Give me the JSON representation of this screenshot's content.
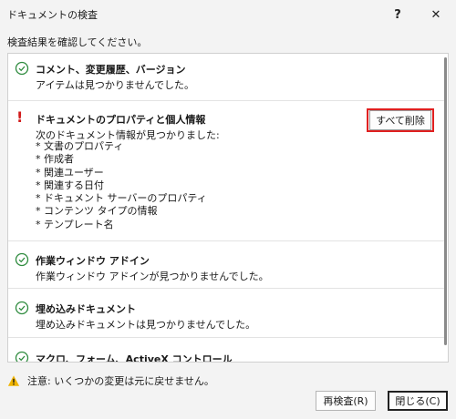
{
  "window": {
    "title": "ドキュメントの検査",
    "help_label": "?",
    "close_label": "✕"
  },
  "instruction": "検査結果を確認してください。",
  "sections": [
    {
      "status": "ok",
      "icon": "check-circle-icon",
      "title": "コメント、変更履歴、バージョン",
      "description": "アイテムは見つかりませんでした。"
    },
    {
      "status": "found",
      "icon": "exclamation-icon",
      "title": "ドキュメントのプロパティと個人情報",
      "description": "次のドキュメント情報が見つかりました:",
      "items": [
        "* 文書のプロパティ",
        "* 作成者",
        "* 関連ユーザー",
        "* 関連する日付",
        "* ドキュメント サーバーのプロパティ",
        "* コンテンツ タイプの情報",
        "* テンプレート名"
      ],
      "action_label": "すべて削除"
    },
    {
      "status": "ok",
      "icon": "check-circle-icon",
      "title": "作業ウィンドウ アドイン",
      "description": "作業ウィンドウ アドインが見つかりませんでした。"
    },
    {
      "status": "ok",
      "icon": "check-circle-icon",
      "title": "埋め込みドキュメント",
      "description": "埋め込みドキュメントは見つかりませんでした。"
    },
    {
      "status": "ok",
      "icon": "check-circle-icon",
      "title": "マクロ、フォーム、ActiveX コントロール"
    }
  ],
  "footer": {
    "warning_icon": "warning-triangle-icon",
    "warning_text": "注意: いくつかの変更は元に戻せません。",
    "recheck_label": "再検査(R)",
    "close_label": "閉じる(C)"
  },
  "colors": {
    "ok_green": "#2e8b3e",
    "alert_red": "#d11a1a",
    "highlight_border": "#e02020",
    "warning_yellow": "#f0b400"
  }
}
